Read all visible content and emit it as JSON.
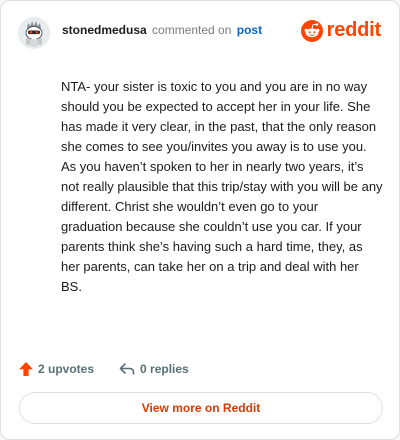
{
  "comment": {
    "username": "stonedmedusa",
    "commented_on": "commented on",
    "post_link": "post",
    "body": "NTA- your sister is toxic to you and you are in no way should you be expected to accept her in your life. She has made it very clear, in the past, that the only reason she comes to see you/invites you away is to use you. As you haven’t spoken to her in nearly two years, it’s not really plausible that this trip/stay with you will be any different. Christ she wouldn’t even go to your graduation because she couldn’t use you car. If your parents think she’s having such a hard time, they, as her parents, can take her on a trip and deal with her BS."
  },
  "brand": {
    "wordmark": "reddit",
    "icon": "reddit-snoo-icon",
    "color": "#ff4500"
  },
  "actions": {
    "upvotes_label": "2 upvotes",
    "replies_label": "0 replies",
    "upvote_icon": "upvote-arrow-icon",
    "reply_icon": "reply-arrow-icon",
    "upvote_color": "#ff4500"
  },
  "footer": {
    "view_more_label": "View more on Reddit",
    "view_more_color": "#d93a00"
  }
}
